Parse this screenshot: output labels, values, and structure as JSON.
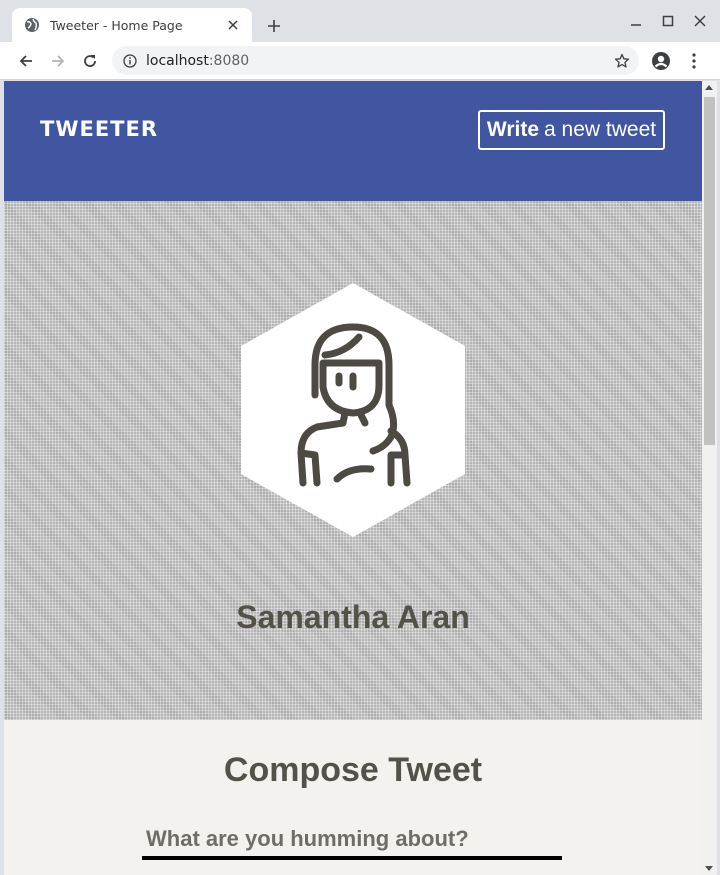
{
  "browser": {
    "tab_title": "Tweeter - Home Page",
    "url_host": "localhost",
    "url_port": ":8080"
  },
  "header": {
    "logo": "TWEETER",
    "write_bold": "Write",
    "write_rest": "a new tweet"
  },
  "profile": {
    "name": "Samantha Aran"
  },
  "compose": {
    "title": "Compose Tweet",
    "placeholder": "What are you humming about?"
  },
  "colors": {
    "header_bg": "#4056a1",
    "text_dark": "#545149",
    "page_bg": "#f4f2ef"
  }
}
